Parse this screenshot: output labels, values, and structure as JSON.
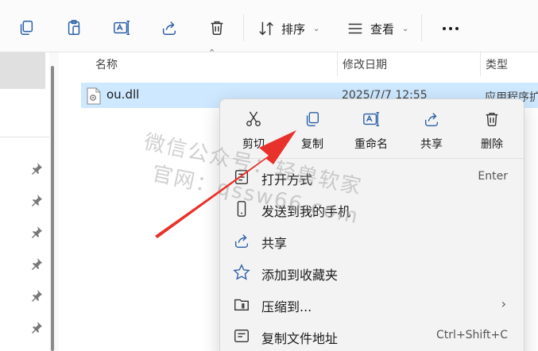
{
  "toolbar": {
    "buttons": [
      {
        "icon": "copy-icon"
      },
      {
        "icon": "paste-icon"
      },
      {
        "icon": "rename-icon"
      },
      {
        "icon": "share-icon"
      },
      {
        "icon": "delete-icon"
      }
    ],
    "sort_label": "排序",
    "view_label": "查看",
    "more_icon": "more-horizontal-icon"
  },
  "columns": {
    "name": "名称",
    "modified": "修改日期",
    "type": "类型"
  },
  "file": {
    "name": "ou.dll",
    "modified": "2025/7/7 12:55",
    "type": "应用程序扩"
  },
  "context_menu": {
    "quick_actions": [
      {
        "label": "剪切",
        "icon": "cut-icon"
      },
      {
        "label": "复制",
        "icon": "copy-icon"
      },
      {
        "label": "重命名",
        "icon": "rename-icon"
      },
      {
        "label": "共享",
        "icon": "share-icon"
      },
      {
        "label": "删除",
        "icon": "delete-icon"
      }
    ],
    "items": [
      {
        "label": "打开方式",
        "shortcut": "Enter",
        "icon": "open-with-icon"
      },
      {
        "label": "发送到我的手机",
        "icon": "phone-icon"
      },
      {
        "label": "共享",
        "icon": "share-icon"
      },
      {
        "label": "添加到收藏夹",
        "icon": "star-icon"
      },
      {
        "label": "压缩到...",
        "icon": "zip-folder-icon",
        "submenu": true
      },
      {
        "label": "复制文件地址",
        "shortcut": "Ctrl+Shift+C",
        "icon": "copy-path-icon"
      }
    ]
  },
  "watermark": {
    "line1": "微信公众号：轻兽软家",
    "line2": "官网：qssw66.com"
  },
  "colors": {
    "selection": "#cde8ff",
    "annotation_arrow": "#e8312a"
  }
}
